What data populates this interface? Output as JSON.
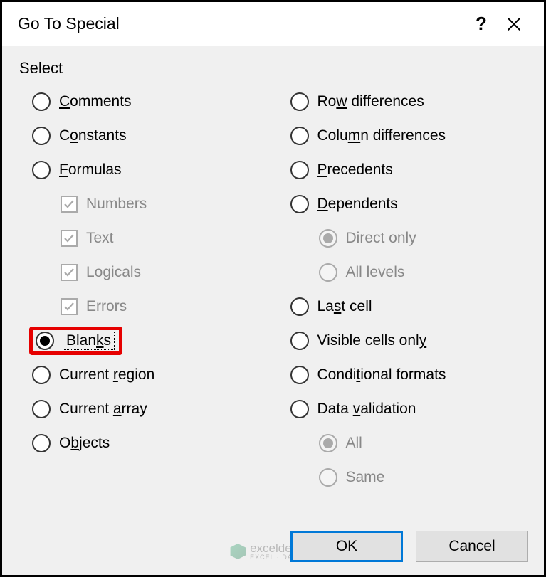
{
  "title": "Go To Special",
  "select_label": "Select",
  "left": {
    "comments": {
      "pre": "",
      "u": "C",
      "post": "omments"
    },
    "constants": {
      "pre": "C",
      "u": "o",
      "post": "nstants"
    },
    "formulas": {
      "pre": "",
      "u": "F",
      "post": "ormulas"
    },
    "sub_numbers": "Numbers",
    "sub_text": "Text",
    "sub_logicals": "Logicals",
    "sub_errors": "Errors",
    "blanks": {
      "pre": "Blan",
      "u": "k",
      "post": "s"
    },
    "current_region": {
      "pre": "Current ",
      "u": "r",
      "post": "egion"
    },
    "current_array": {
      "pre": "Current ",
      "u": "a",
      "post": "rray"
    },
    "objects": {
      "pre": "O",
      "u": "b",
      "post": "jects"
    }
  },
  "right": {
    "row_diff": {
      "pre": "Ro",
      "u": "w",
      "post": " differences"
    },
    "col_diff": {
      "pre": "Colu",
      "u": "m",
      "post": "n differences"
    },
    "precedents": {
      "pre": "",
      "u": "P",
      "post": "recedents"
    },
    "dependents": {
      "pre": "",
      "u": "D",
      "post": "ependents"
    },
    "direct_only": "Direct only",
    "all_levels": "All levels",
    "last_cell": {
      "pre": "La",
      "u": "s",
      "post": "t cell"
    },
    "visible": {
      "pre": "Visible cells onl",
      "u": "y",
      "post": ""
    },
    "cond_formats": {
      "pre": "Condi",
      "u": "t",
      "post": "ional formats"
    },
    "data_val": {
      "pre": "Data ",
      "u": "v",
      "post": "alidation"
    },
    "all": "All",
    "same": "Same"
  },
  "buttons": {
    "ok": "OK",
    "cancel": "Cancel"
  },
  "watermark": {
    "name": "exceldemy",
    "tag": "EXCEL · DATA · BI"
  }
}
